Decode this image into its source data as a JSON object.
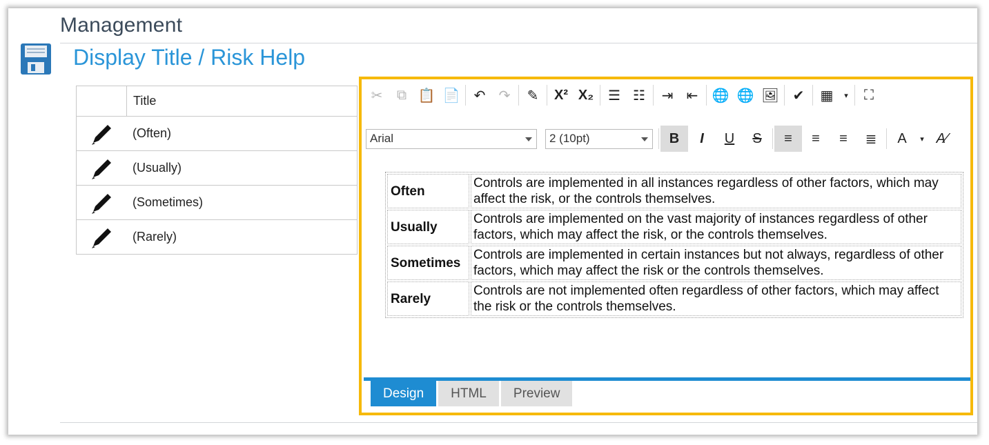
{
  "header": {
    "section": "Management",
    "page_title": "Display Title / Risk Help"
  },
  "list": {
    "column_title": "Title",
    "items": [
      "(Often)",
      "(Usually)",
      "(Sometimes)",
      "(Rarely)"
    ]
  },
  "toolbar": {
    "font_name": "Arial",
    "font_size": "2 (10pt)",
    "bold": "B",
    "italic": "I",
    "underline": "U",
    "strike": "S"
  },
  "content": {
    "rows": [
      {
        "term": "Often",
        "desc": "Controls are implemented in all instances regardless of other factors, which may affect the risk, or the controls themselves."
      },
      {
        "term": "Usually",
        "desc": "Controls are implemented on the vast majority of instances regardless of other factors, which may affect the risk, or the controls themselves."
      },
      {
        "term": "Sometimes",
        "desc": "Controls are implemented in certain instances but not always, regardless of other factors, which may affect the risk or the controls themselves."
      },
      {
        "term": "Rarely",
        "desc": "Controls are not implemented often regardless of other factors, which may affect the risk or the controls themselves."
      }
    ]
  },
  "tabs": [
    "Design",
    "HTML",
    "Preview"
  ],
  "colors": {
    "accent": "#2a95d8",
    "highlight_border": "#f6b90a",
    "active_tab": "#1e8cd2"
  }
}
